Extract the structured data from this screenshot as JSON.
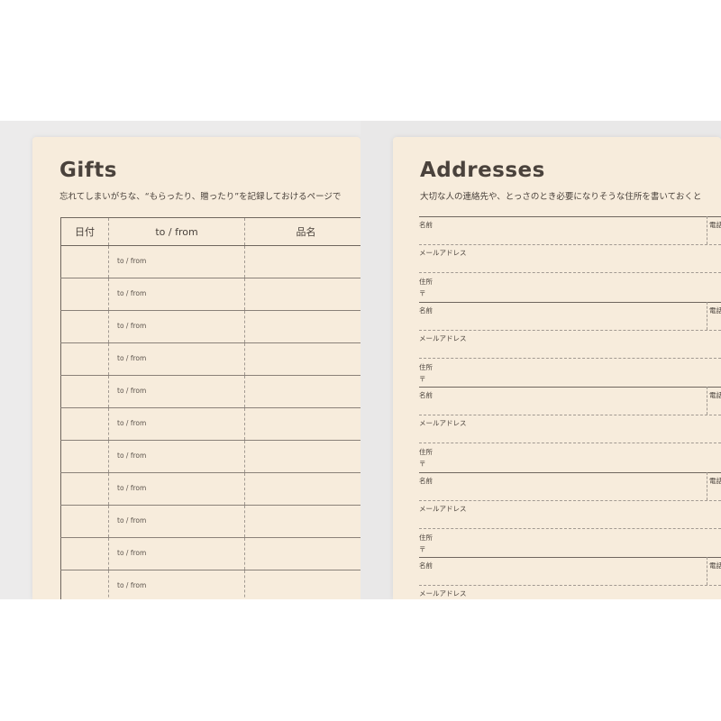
{
  "gifts": {
    "title": "Gifts",
    "subtitle": "忘れてしまいがちな、“もらったり、贈ったり”を記録しておけるページで",
    "columns": {
      "date": "日付",
      "to_from": "to / from",
      "item": "品名"
    },
    "rows": [
      {
        "to_from": "to / from"
      },
      {
        "to_from": "to / from"
      },
      {
        "to_from": "to / from"
      },
      {
        "to_from": "to / from"
      },
      {
        "to_from": "to / from"
      },
      {
        "to_from": "to / from"
      },
      {
        "to_from": "to / from"
      },
      {
        "to_from": "to / from"
      },
      {
        "to_from": "to / from"
      },
      {
        "to_from": "to / from"
      },
      {
        "to_from": "to / from"
      }
    ]
  },
  "addresses": {
    "title": "Addresses",
    "subtitle": "大切な人の連絡先や、とっさのとき必要になりそうな住所を書いておくと",
    "entries": [
      {
        "name": "名前",
        "phone": "電話",
        "email": "メールアドレス",
        "address": "住所",
        "zip": "〒"
      },
      {
        "name": "名前",
        "phone": "電話",
        "email": "メールアドレス",
        "address": "住所",
        "zip": "〒"
      },
      {
        "name": "名前",
        "phone": "電話",
        "email": "メールアドレス",
        "address": "住所",
        "zip": "〒"
      },
      {
        "name": "名前",
        "phone": "電話",
        "email": "メールアドレス",
        "address": "住所",
        "zip": "〒"
      },
      {
        "name": "名前",
        "phone": "電話",
        "email": "メールアドレス"
      }
    ]
  },
  "colors": {
    "paper": "#f7ecdc",
    "ink": "#4a423c",
    "backdrop": "#ecebeb"
  }
}
